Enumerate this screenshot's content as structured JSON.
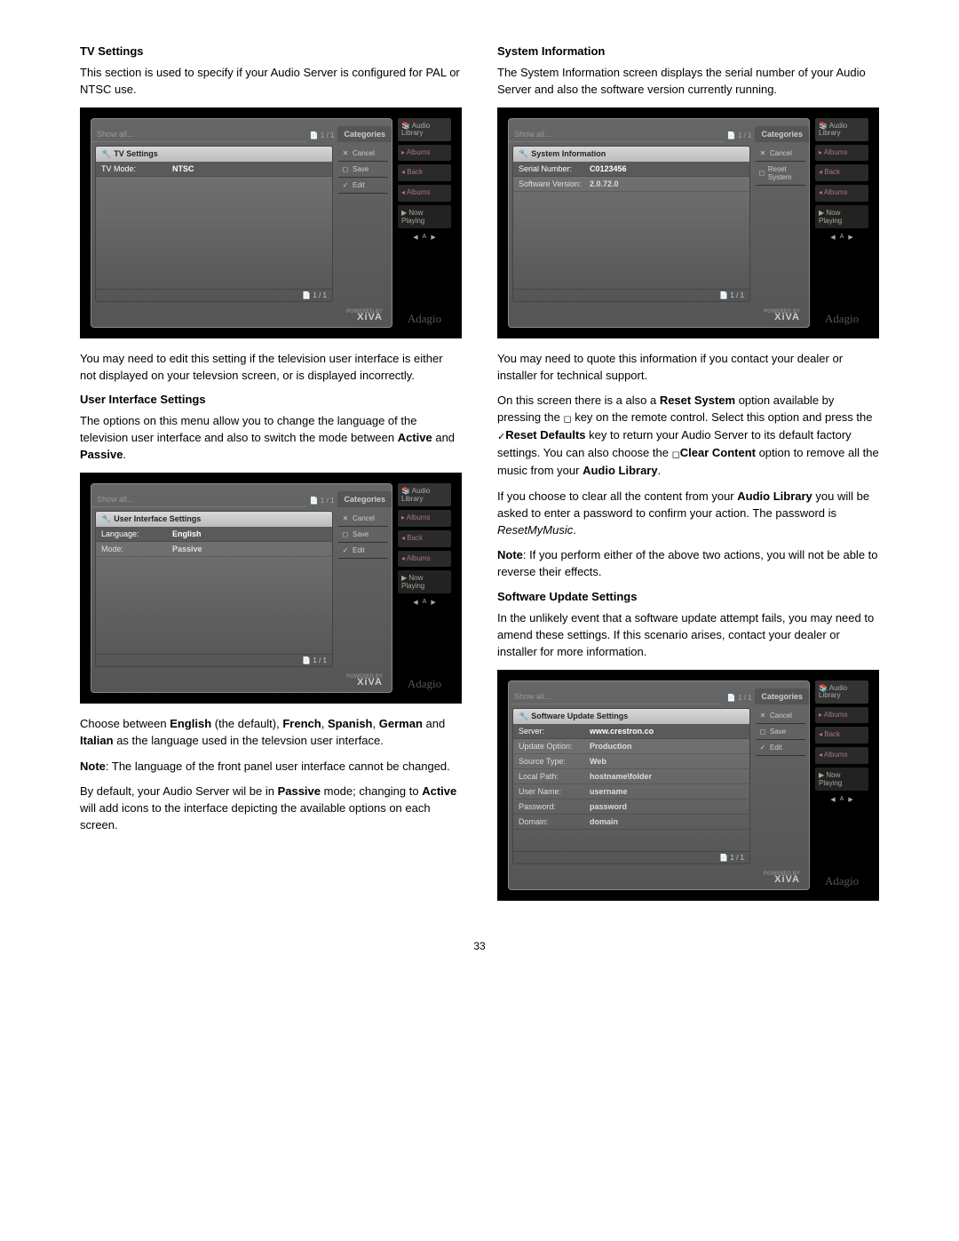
{
  "page_number": "33",
  "left": {
    "tv": {
      "heading": "TV Settings",
      "p1": "This section is used to specify if your Audio Server is configured for PAL or NTSC use.",
      "p2": "You may need to edit this setting if the television user interface is either not displayed on your televsion screen, or is displayed incorrectly."
    },
    "ui": {
      "heading": "User Interface Settings",
      "p1": "The options on this menu allow you to change the language of the television user interface and also to switch the mode between ",
      "active": "Active",
      "and": " and ",
      "passive": "Passive",
      "dot": ".",
      "p2a": "Choose between ",
      "english": "English",
      "p2b": " (the default), ",
      "french": "French",
      "comma1": ", ",
      "spanish": "Spanish",
      "comma2": ", ",
      "german": "German",
      "and2": " and ",
      "italian": "Italian",
      "p2c": " as the language used in the televsion user interface.",
      "note_label": "Note",
      "note_text": ": The language of the front panel user interface cannot be changed.",
      "p3a": "By default, your Audio Server wil be in ",
      "p3b": " mode; changing to ",
      "p3c": " will add icons to the interface depicting the available options on each screen."
    }
  },
  "right": {
    "sys": {
      "heading": "System Information",
      "p1": "The System Information screen displays the serial number of your Audio Server and also the software version currently running.",
      "p2": "You may need to quote this information if you contact your dealer or installer for technical support.",
      "p3a": "On this screen there is a also a ",
      "reset_system": "Reset System",
      "p3b": " option available by pressing the ",
      "p3c": " key on the remote control. Select this option and press the ",
      "reset_defaults": "Reset Defaults",
      "p3d": " key to return your Audio Server to its default factory settings. You can also choose the ",
      "clear_content": "Clear Content",
      "p3e": " option to remove all the music from your ",
      "audio_library": "Audio Library",
      "dot": ".",
      "p4a": "If you choose to clear all the content from your ",
      "p4b": " you will be asked to enter a password to confirm your action.  The password is ",
      "password": "ResetMyMusic",
      "note_label": "Note",
      "note_text": ": If you perform either of the above two actions, you will not be able to reverse their effects."
    },
    "sw": {
      "heading": "Software Update Settings",
      "p1": "In the unlikely event that a software update attempt fails, you may need to amend these settings.  If this scenario arises, contact your dealer or installer for more information."
    }
  },
  "shot_common": {
    "show_all": "Show all...",
    "page_ind": "1 / 1",
    "categories": "Categories",
    "audio_library": "Audio Library",
    "albums": "Albums",
    "back": "Back",
    "now_playing": "Now Playing",
    "powered_by": "POWERED BY",
    "xiva": "XiVA",
    "adagio": "Adagio",
    "cancel": "Cancel",
    "save": "Save",
    "edit": "Edit",
    "page_foot": "1 / 1"
  },
  "shot1": {
    "title": "TV Settings",
    "rows": [
      {
        "lab": "TV Mode:",
        "val": "NTSC",
        "hl": true
      }
    ]
  },
  "shot2": {
    "title": "User Interface Settings",
    "rows": [
      {
        "lab": "Language:",
        "val": "English",
        "hl": true
      },
      {
        "lab": "Mode:",
        "val": "Passive",
        "hl": false
      }
    ]
  },
  "shot3": {
    "title": "System Information",
    "rows": [
      {
        "lab": "Serial Number:",
        "val": "C0123456",
        "hl": true
      },
      {
        "lab": "Software Version:",
        "val": "2.0.72.0",
        "hl": false
      }
    ],
    "reset_btn": "Reset System"
  },
  "shot4": {
    "title": "Software Update Settings",
    "rows": [
      {
        "lab": "Server:",
        "val": "www.crestron.co",
        "hl": true
      },
      {
        "lab": "Update Option:",
        "val": "Production",
        "hl": false
      },
      {
        "lab": "Source Type:",
        "val": "Web",
        "hl": false
      },
      {
        "lab": "Local Path:",
        "val": "hostname\\folder",
        "hl": false
      },
      {
        "lab": "User Name:",
        "val": "username",
        "hl": false
      },
      {
        "lab": "Password:",
        "val": "password",
        "hl": false
      },
      {
        "lab": "Domain:",
        "val": "domain",
        "hl": false
      }
    ]
  }
}
